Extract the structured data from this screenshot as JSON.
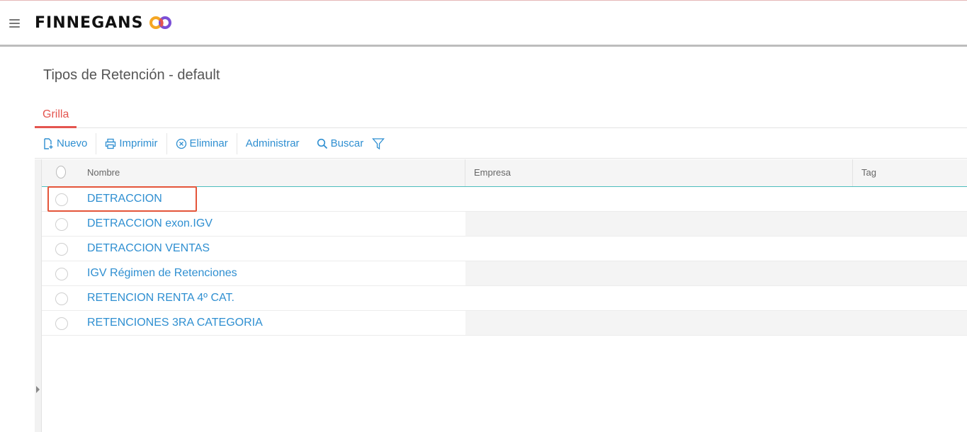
{
  "header": {
    "brand": "FINNEGANS",
    "menu_icon": "hamburger-icon",
    "logo_icon": "infinity-logo-icon",
    "colors": {
      "logo_orange": "#f5a623",
      "logo_purple": "#7b4fd6",
      "accent": "#e4554f",
      "link": "#2f8fd1"
    }
  },
  "page": {
    "title": "Tipos de Retención - default"
  },
  "tabs": [
    {
      "label": "Grilla",
      "active": true
    }
  ],
  "toolbar": {
    "nuevo": "Nuevo",
    "imprimir": "Imprimir",
    "eliminar": "Eliminar",
    "administrar": "Administrar",
    "buscar": "Buscar",
    "filter_icon": "filter-icon"
  },
  "grid": {
    "columns": [
      "Nombre",
      "Empresa",
      "Tag"
    ],
    "rows": [
      {
        "nombre": "DETRACCION",
        "empresa": "",
        "tag": ""
      },
      {
        "nombre": "DETRACCION exon.IGV",
        "empresa": "",
        "tag": ""
      },
      {
        "nombre": "DETRACCION VENTAS",
        "empresa": "",
        "tag": ""
      },
      {
        "nombre": "IGV Régimen de Retenciones",
        "empresa": "",
        "tag": ""
      },
      {
        "nombre": "RETENCION RENTA 4º CAT.",
        "empresa": "",
        "tag": ""
      },
      {
        "nombre": "RETENCIONES 3RA CATEGORIA",
        "empresa": "",
        "tag": ""
      }
    ]
  }
}
